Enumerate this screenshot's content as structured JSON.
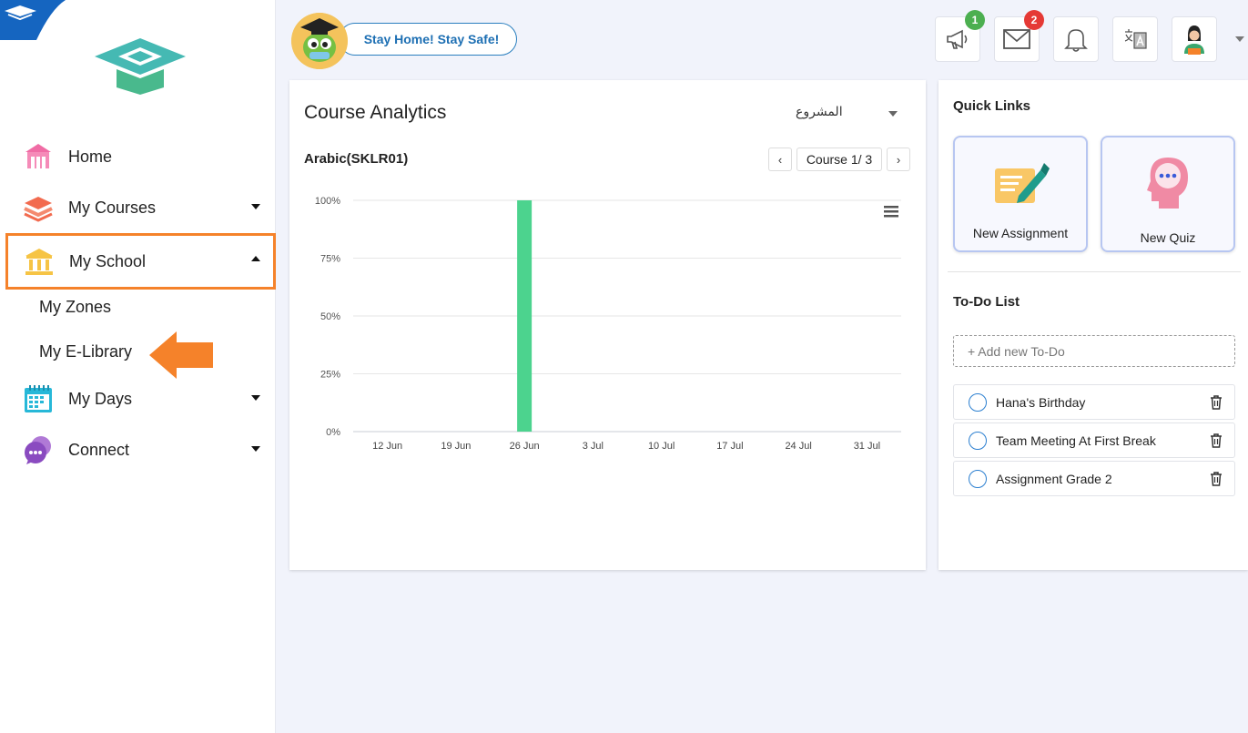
{
  "sidebar": {
    "items": [
      {
        "label": "Home"
      },
      {
        "label": "My Courses"
      },
      {
        "label": "My School"
      },
      {
        "label": "My Days"
      },
      {
        "label": "Connect"
      }
    ],
    "school_sub_items": [
      {
        "label": "My Zones"
      },
      {
        "label": "My E-Library"
      }
    ]
  },
  "header": {
    "banner": "Stay Home! Stay Safe!",
    "badges": {
      "announcements": "1",
      "messages": "2"
    },
    "colors": {
      "announcements_badge": "#4caf50",
      "messages_badge": "#e53935"
    }
  },
  "analytics": {
    "title": "Course Analytics",
    "project_select": "المشروع",
    "course_name": "Arabic(SKLR01)",
    "pager": {
      "prev": "‹",
      "label": "Course 1/ 3",
      "next": "›"
    }
  },
  "chart_data": {
    "type": "bar",
    "categories": [
      "12 Jun",
      "19 Jun",
      "26 Jun",
      "3 Jul",
      "10 Jul",
      "17 Jul",
      "24 Jul",
      "31 Jul"
    ],
    "ticks": [
      "0%",
      "25%",
      "50%",
      "75%",
      "100%"
    ],
    "ylim": [
      0,
      100
    ],
    "bars": [
      {
        "x_position": 2.0,
        "value": 100
      }
    ],
    "color": "#4cd38e",
    "grid": true
  },
  "quick_links": {
    "title": "Quick Links",
    "items": [
      {
        "label": "New Assignment",
        "icon": "assignment-pen-icon"
      },
      {
        "label": "New Quiz",
        "icon": "quiz-head-icon"
      }
    ]
  },
  "todo": {
    "title": "To-Do List",
    "placeholder": "+ Add new To-Do",
    "items": [
      {
        "text": "Hana's Birthday"
      },
      {
        "text": "Team Meeting At First Break"
      },
      {
        "text": "Assignment Grade 2"
      }
    ]
  },
  "colors": {
    "accent_orange": "#f5822a",
    "chart_bar": "#4cd38e",
    "tile_border": "#b7c6f1"
  }
}
